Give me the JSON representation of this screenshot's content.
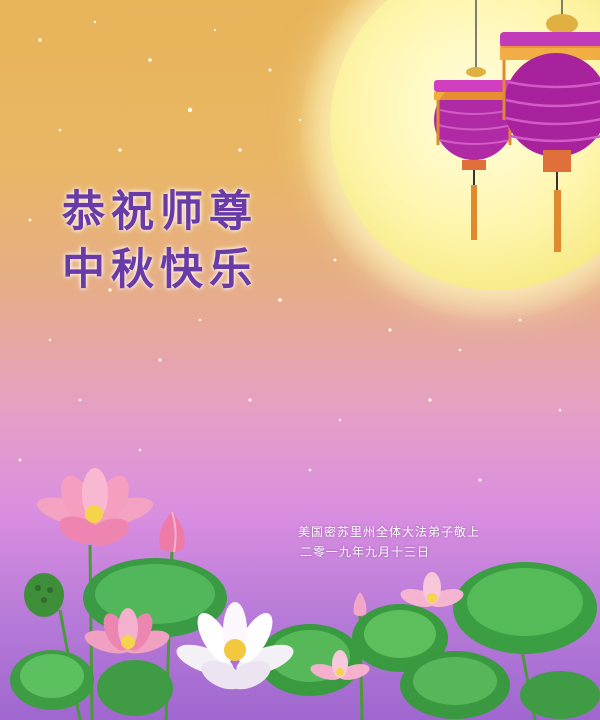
{
  "greeting": {
    "line1": "恭祝师尊",
    "line2": "中秋快乐"
  },
  "signature": {
    "sender": "美国密苏里州全体大法弟子敬上",
    "date": "二零一九年九月十三日"
  },
  "colors": {
    "sky_top": "#e8b45a",
    "sky_bottom": "#9f67cf",
    "moon": "#fff6b0",
    "greeting_text": "#6a3aa7",
    "lantern": "#b12aa6",
    "lotus_leaf": "#3fa84a",
    "lotus_pink": "#f08cb4"
  },
  "icons": [
    "full-moon",
    "lantern-small",
    "lantern-large",
    "lotus-flower",
    "lotus-leaf",
    "lotus-seedpod",
    "lotus-bud"
  ]
}
